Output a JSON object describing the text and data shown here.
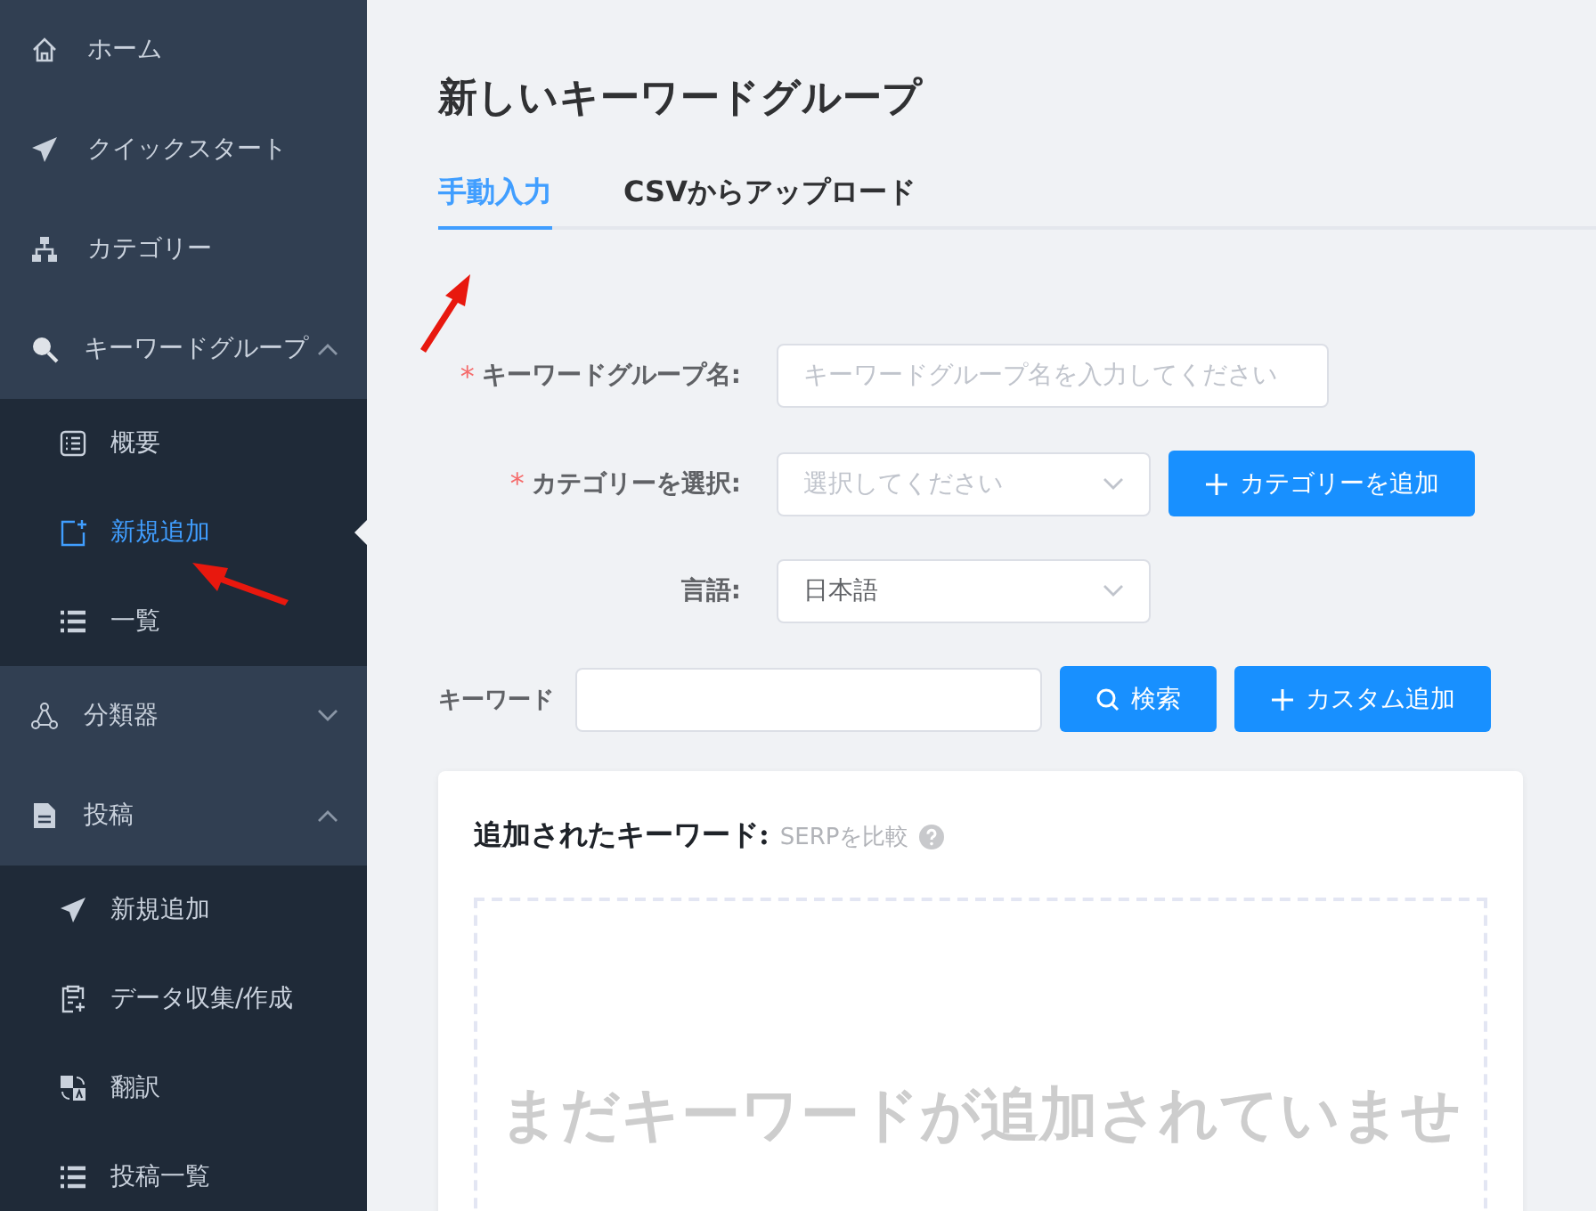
{
  "sidebar": {
    "items": [
      {
        "kind": "link",
        "label": "ホーム",
        "selected": false
      },
      {
        "kind": "link",
        "label": "クイックスタート",
        "selected": false
      },
      {
        "kind": "link",
        "label": "カテゴリー",
        "selected": false
      },
      {
        "kind": "group",
        "label": "キーワードグループ",
        "expanded": true,
        "children": [
          {
            "label": "概要",
            "selected": false
          },
          {
            "label": "新規追加",
            "selected": true
          },
          {
            "label": "一覧",
            "selected": false
          }
        ]
      },
      {
        "kind": "group",
        "label": "分類器",
        "expanded": false
      },
      {
        "kind": "group",
        "label": "投稿",
        "expanded": true,
        "children": [
          {
            "label": "新規追加",
            "selected": false
          },
          {
            "label": "データ収集/作成",
            "selected": false
          },
          {
            "label": "翻訳",
            "selected": false
          },
          {
            "label": "投稿一覧",
            "selected": false
          }
        ]
      }
    ]
  },
  "page": {
    "title": "新しいキーワードグループ",
    "tabs": [
      {
        "label": "手動入力",
        "selected": true
      },
      {
        "label": "CSVからアップロード",
        "selected": false
      }
    ],
    "form": [
      {
        "kind": "input",
        "required_mark": "*",
        "label": "キーワードグループ名:",
        "placeholder": "キーワードグループ名を入力してください"
      },
      {
        "kind": "select",
        "required_mark": "*",
        "label": "カテゴリーを選択:",
        "placeholder": "選択してください",
        "button": "カテゴリーを追加"
      },
      {
        "kind": "select",
        "label": "言語:",
        "value": "日本語"
      }
    ],
    "keyword_row": {
      "label": "キーワード",
      "search_button": "検索",
      "add_button": "カスタム追加"
    },
    "card": {
      "title": "追加されたキーワード:",
      "link": "SERPを比較",
      "empty_text": "まだキーワードが追加されていませ"
    }
  }
}
